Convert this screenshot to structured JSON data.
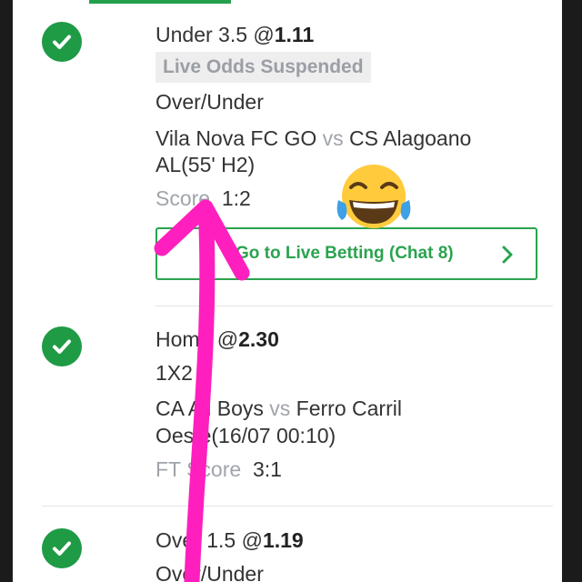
{
  "bets": [
    {
      "selection": "Under 3.5 @",
      "odds": "1.11",
      "suspended": "Live Odds Suspended",
      "market": "Over/Under",
      "home_team": "Vila Nova FC GO",
      "vs": "vs",
      "away_team": "CS Alagoano",
      "match_info": "AL(55' H2)",
      "score_label": "Score",
      "score": "1:2",
      "live_button": "Go to Live Betting (Chat 8)"
    },
    {
      "selection": "Home @",
      "odds": "2.30",
      "market": "1X2",
      "home_team": "CA All Boys",
      "vs": "vs",
      "away_team": "Ferro Carril",
      "match_info": "Oeste(16/07 00:10)",
      "score_label": "FT Score",
      "score": "3:1"
    },
    {
      "selection": "Over 1.5 @",
      "odds": "1.19",
      "market": "Over/Under"
    }
  ],
  "colors": {
    "accent_green": "#2aa34f",
    "check_green": "#1f9a45",
    "annotation_pink": "#ff1fbe"
  },
  "icons": {
    "status": "check-circle-icon",
    "chevron": "chevron-right-icon",
    "reaction": "tears-of-joy-emoji"
  }
}
